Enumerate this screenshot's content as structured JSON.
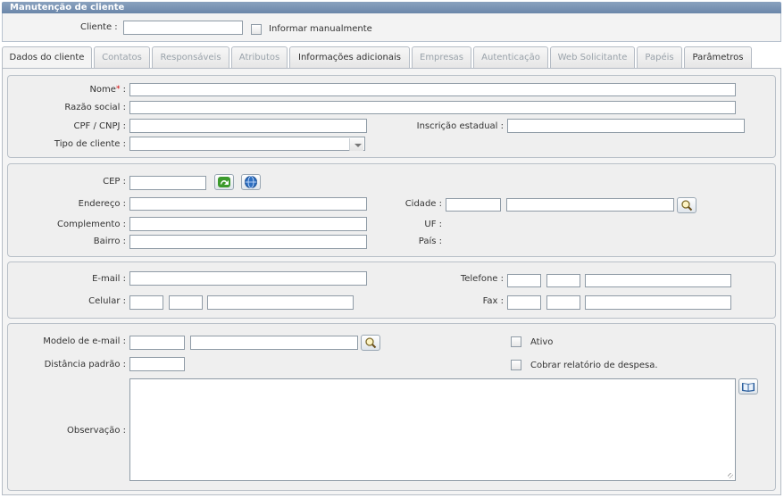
{
  "panel": {
    "title": "Manutenção de cliente"
  },
  "client_bar": {
    "cliente_label": "Cliente :",
    "cliente_value": "",
    "manual_label": "Informar manualmente"
  },
  "tabs": [
    {
      "label": "Dados do cliente",
      "state": "active"
    },
    {
      "label": "Contatos",
      "state": "disabled"
    },
    {
      "label": "Responsáveis",
      "state": "disabled"
    },
    {
      "label": "Atributos",
      "state": "disabled"
    },
    {
      "label": "Informações adicionais",
      "state": "enabled"
    },
    {
      "label": "Empresas",
      "state": "disabled"
    },
    {
      "label": "Autenticação",
      "state": "disabled"
    },
    {
      "label": "Web Solicitante",
      "state": "disabled"
    },
    {
      "label": "Papéis",
      "state": "disabled"
    },
    {
      "label": "Parâmetros",
      "state": "enabled"
    }
  ],
  "identity": {
    "nome_label": "Nome",
    "nome_required_mark": "*",
    "nome_colon": ":",
    "razao_label": "Razão social :",
    "cpf_label": "CPF / CNPJ :",
    "inscricao_label": "Inscrição estadual :",
    "tipo_label": "Tipo de cliente :"
  },
  "address": {
    "cep_label": "CEP :",
    "endereco_label": "Endereço :",
    "cidade_label": "Cidade :",
    "complemento_label": "Complemento :",
    "uf_label": "UF :",
    "bairro_label": "Bairro :",
    "pais_label": "País :"
  },
  "contact": {
    "email_label": "E-mail :",
    "telefone_label": "Telefone :",
    "celular_label": "Celular :",
    "fax_label": "Fax :"
  },
  "extra": {
    "modelo_label": "Modelo de e-mail :",
    "ativo_label": "Ativo",
    "distancia_label": "Distância padrão :",
    "cobrar_label": "Cobrar relatório de despesa.",
    "observacao_label": "Observação :"
  },
  "colors": {
    "title_bar": "#7892b4",
    "accent_green": "#3c9a2c",
    "globe_blue": "#2e6fc0"
  }
}
